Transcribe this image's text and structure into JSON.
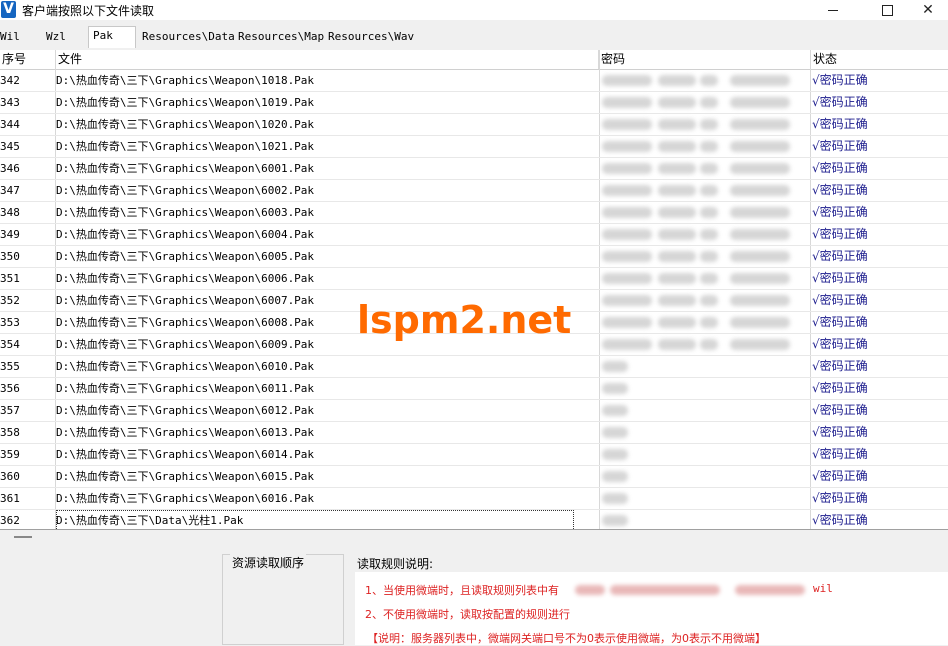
{
  "window": {
    "title": "客户端按照以下文件读取",
    "icon_letter": "V",
    "close_glyph": "✕"
  },
  "tabs": [
    "Wil",
    "Wzl",
    "Pak",
    "Resources\\Data",
    "Resources\\Map",
    "Resources\\Wav"
  ],
  "active_tab": "Pak",
  "table": {
    "columns": [
      "序号",
      "文件",
      "密码",
      "状态"
    ],
    "rows": [
      {
        "seq": "342",
        "file": "D:\\热血传奇\\三下\\Graphics\\Weapon\\1018.Pak",
        "status": "√密码正确"
      },
      {
        "seq": "343",
        "file": "D:\\热血传奇\\三下\\Graphics\\Weapon\\1019.Pak",
        "status": "√密码正确"
      },
      {
        "seq": "344",
        "file": "D:\\热血传奇\\三下\\Graphics\\Weapon\\1020.Pak",
        "status": "√密码正确"
      },
      {
        "seq": "345",
        "file": "D:\\热血传奇\\三下\\Graphics\\Weapon\\1021.Pak",
        "status": "√密码正确"
      },
      {
        "seq": "346",
        "file": "D:\\热血传奇\\三下\\Graphics\\Weapon\\6001.Pak",
        "status": "√密码正确"
      },
      {
        "seq": "347",
        "file": "D:\\热血传奇\\三下\\Graphics\\Weapon\\6002.Pak",
        "status": "√密码正确"
      },
      {
        "seq": "348",
        "file": "D:\\热血传奇\\三下\\Graphics\\Weapon\\6003.Pak",
        "status": "√密码正确"
      },
      {
        "seq": "349",
        "file": "D:\\热血传奇\\三下\\Graphics\\Weapon\\6004.Pak",
        "status": "√密码正确"
      },
      {
        "seq": "350",
        "file": "D:\\热血传奇\\三下\\Graphics\\Weapon\\6005.Pak",
        "status": "√密码正确"
      },
      {
        "seq": "351",
        "file": "D:\\热血传奇\\三下\\Graphics\\Weapon\\6006.Pak",
        "status": "√密码正确"
      },
      {
        "seq": "352",
        "file": "D:\\热血传奇\\三下\\Graphics\\Weapon\\6007.Pak",
        "status": "√密码正确"
      },
      {
        "seq": "353",
        "file": "D:\\热血传奇\\三下\\Graphics\\Weapon\\6008.Pak",
        "status": "√密码正确"
      },
      {
        "seq": "354",
        "file": "D:\\热血传奇\\三下\\Graphics\\Weapon\\6009.Pak",
        "status": "√密码正确"
      },
      {
        "seq": "355",
        "file": "D:\\热血传奇\\三下\\Graphics\\Weapon\\6010.Pak",
        "status": "√密码正确"
      },
      {
        "seq": "356",
        "file": "D:\\热血传奇\\三下\\Graphics\\Weapon\\6011.Pak",
        "status": "√密码正确"
      },
      {
        "seq": "357",
        "file": "D:\\热血传奇\\三下\\Graphics\\Weapon\\6012.Pak",
        "status": "√密码正确"
      },
      {
        "seq": "358",
        "file": "D:\\热血传奇\\三下\\Graphics\\Weapon\\6013.Pak",
        "status": "√密码正确"
      },
      {
        "seq": "359",
        "file": "D:\\热血传奇\\三下\\Graphics\\Weapon\\6014.Pak",
        "status": "√密码正确"
      },
      {
        "seq": "360",
        "file": "D:\\热血传奇\\三下\\Graphics\\Weapon\\6015.Pak",
        "status": "√密码正确"
      },
      {
        "seq": "361",
        "file": "D:\\热血传奇\\三下\\Graphics\\Weapon\\6016.Pak",
        "status": "√密码正确"
      },
      {
        "seq": "362",
        "file": "D:\\热血传奇\\三下\\Data\\光柱1.Pak",
        "status": "√密码正确"
      }
    ]
  },
  "bottom": {
    "load_order_title": "资源读取顺序",
    "rules_title": "读取规则说明:",
    "rule1": "1、当使用微端时，且读取规则列表中有",
    "rule1_tail": "wil",
    "rule2": "2、不使用微端时，读取按配置的规则进行",
    "rule3": "【说明：服务器列表中，微端网关端口号不为0表示使用微端，为0表示不用微端】"
  },
  "watermark": "lspm2.net",
  "colors": {
    "status_text": "#1a1a8c",
    "rule_text": "#dd2222",
    "watermark": "#ff6a00"
  }
}
